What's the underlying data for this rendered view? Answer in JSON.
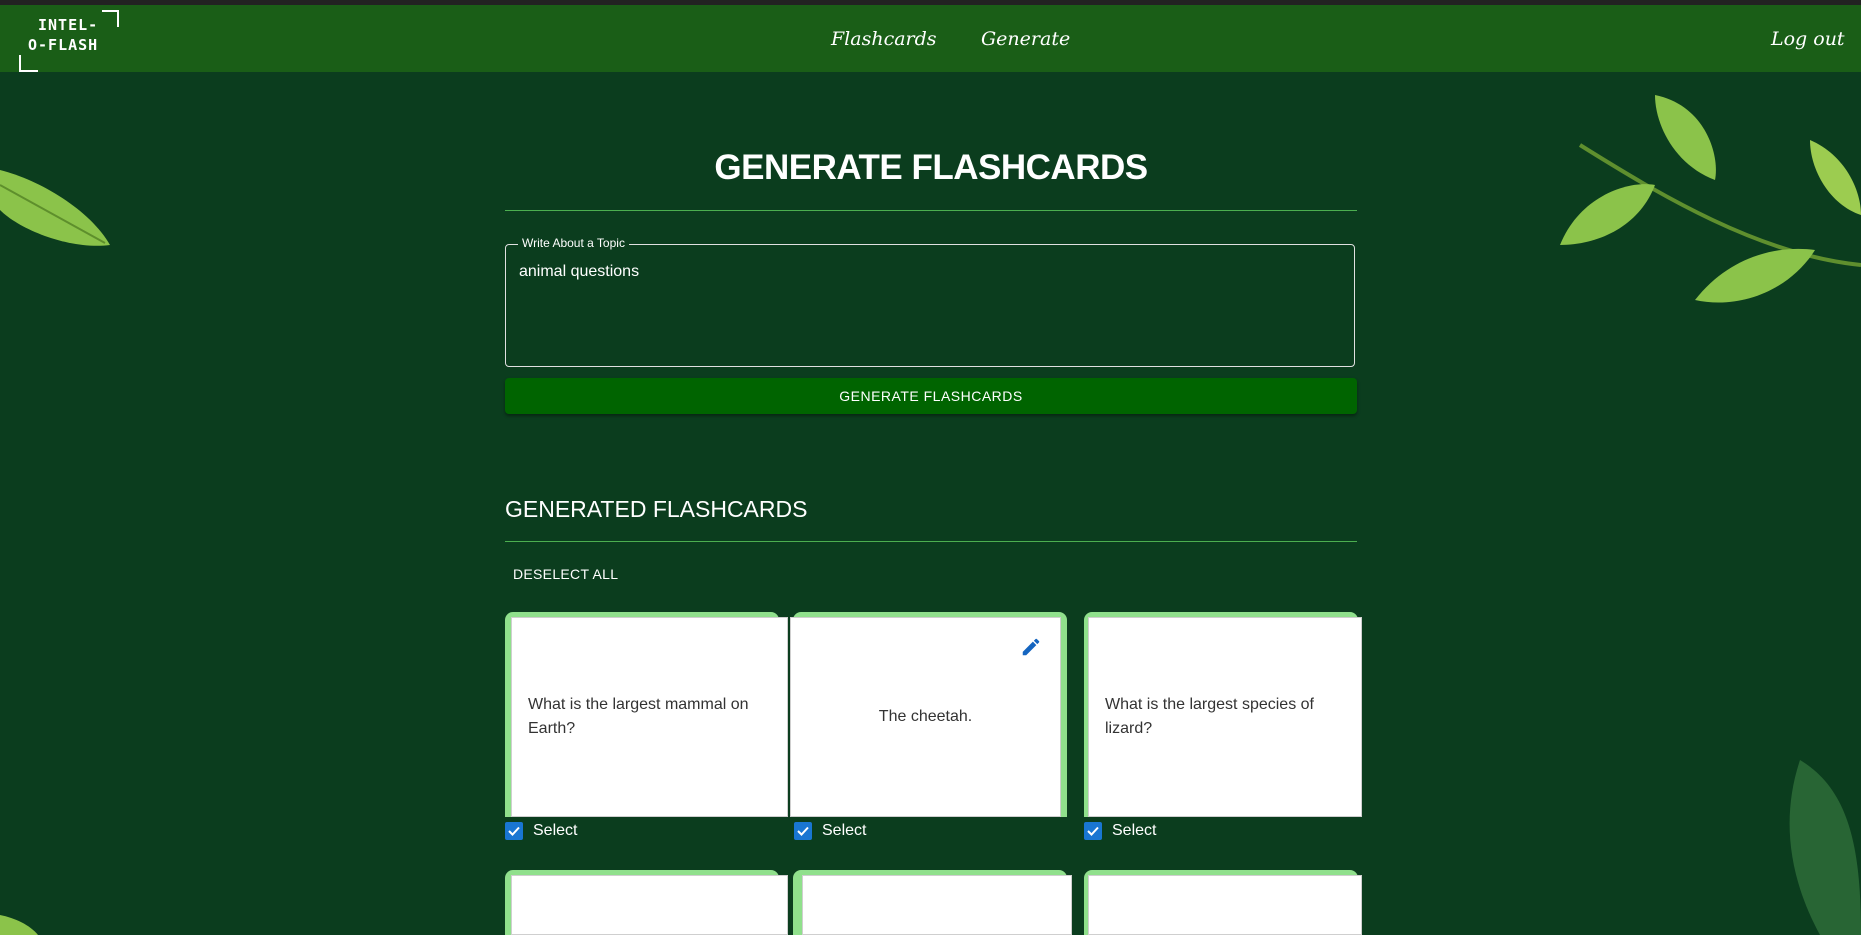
{
  "nav": {
    "logo_line1": "INTEL-",
    "logo_line2": "O-FLASH",
    "links": [
      "Flashcards",
      "Generate"
    ],
    "logout": "Log out"
  },
  "main": {
    "title": "GENERATE FLASHCARDS",
    "topic_label": "Write About a Topic",
    "topic_value": "animal questions",
    "generate_button": "GENERATE FLASHCARDS",
    "generated_title": "GENERATED FLASHCARDS",
    "deselect_all": "DESELECT ALL"
  },
  "cards": [
    {
      "text": "What is the largest mammal on Earth?",
      "selected": true,
      "select_label": "Select"
    },
    {
      "text": "The cheetah.",
      "selected": true,
      "select_label": "Select"
    },
    {
      "text": "What is the largest species of lizard?",
      "selected": true,
      "select_label": "Select"
    }
  ],
  "colors": {
    "navbar": "#1a5e17",
    "background": "#0b3d1e",
    "button": "#006400",
    "card_accent": "#90e08c",
    "checkbox": "#1976d2",
    "leaf": "#8bc34a"
  },
  "icons": [
    "edit-icon",
    "checkbox-checked-icon",
    "leaf-icon"
  ]
}
